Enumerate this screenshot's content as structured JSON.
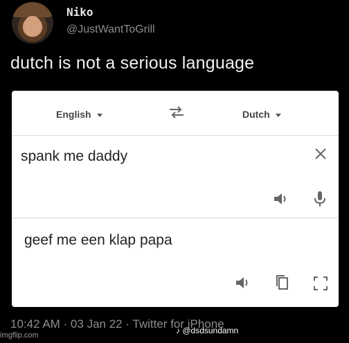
{
  "tweet": {
    "display_name": "Niko",
    "handle": "@JustWantToGrill",
    "text": "dutch is not a serious language",
    "timestamp": "10:42 AM · 03 Jan 22 · Twitter for iPhone"
  },
  "translator": {
    "source_language": "English",
    "target_language": "Dutch",
    "input_text": "spank me daddy",
    "output_text": "geef me een klap papa"
  },
  "overlays": {
    "tiktok_label": "♪ @dsdsundamn",
    "watermark": "imgflip.com"
  }
}
